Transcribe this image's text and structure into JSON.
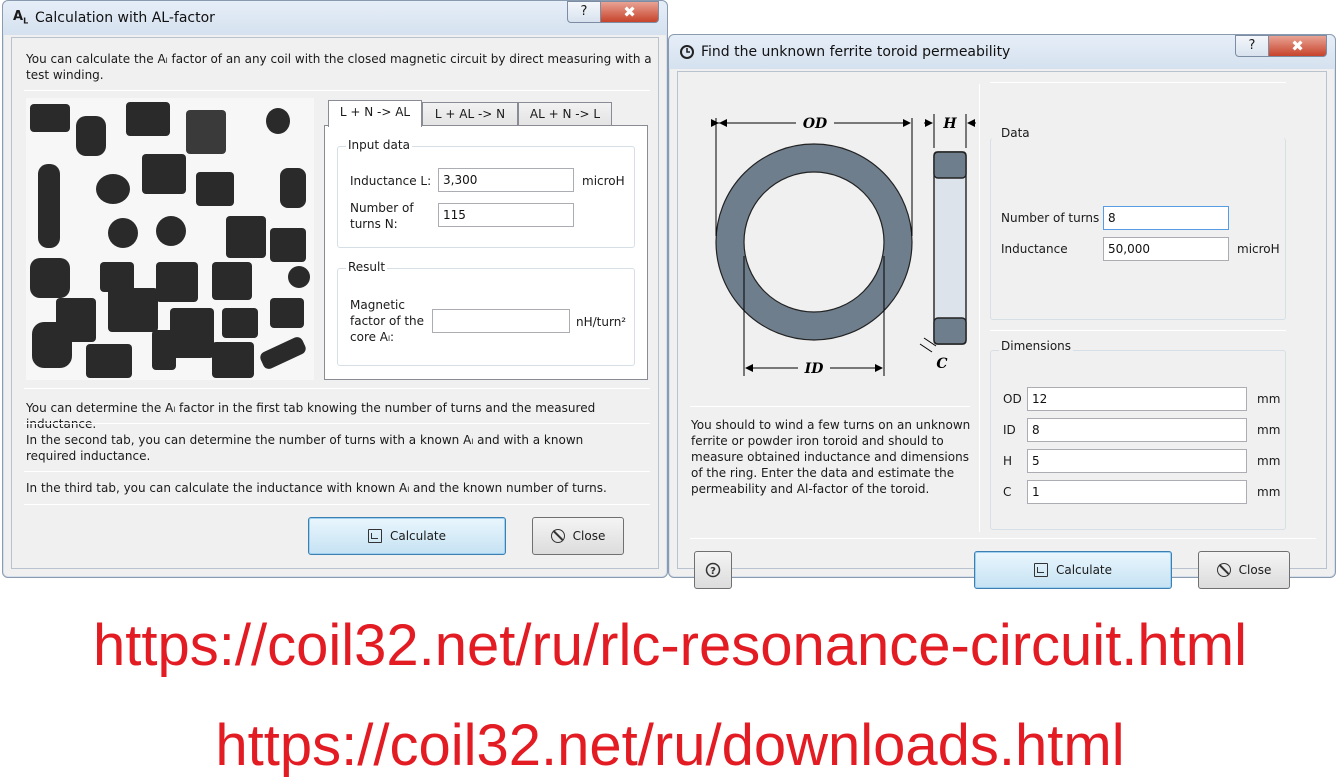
{
  "colors": {
    "url": "#e31b23",
    "accent": "#3c7fb1"
  },
  "left_window": {
    "icon": "A",
    "icon_sub": "L",
    "title": "Calculation with AL-factor",
    "intro": "You can calculate the Aₗ factor of an any coil with the closed magnetic circuit by direct measuring with a test winding.",
    "tabs": [
      "L + N -> AL",
      "L + AL -> N",
      "AL + N -> L"
    ],
    "input_group": "Input data",
    "inductance_label": "Inductance L:",
    "inductance_value": "3,300",
    "inductance_unit": "microH",
    "turns_label": "Number of turns N:",
    "turns_value": "115",
    "result_group": "Result",
    "factor_label": "Magnetic factor of the core Aₗ:",
    "factor_value": "",
    "factor_unit": "nH/turn²",
    "note1": "You can determine the Aₗ factor in the first tab knowing the number of turns and the measured inductance.",
    "note2": "In the second tab, you can determine the number of turns with a known Aₗ and with a known required inductance.",
    "note3": "In the third tab, you can calculate the inductance with known Aₗ and the known number of turns.",
    "calculate": "Calculate",
    "close": "Close",
    "help_glyph": "?",
    "close_glyph": "✖"
  },
  "right_window": {
    "title": "Find the unknown ferrite toroid permeability",
    "drawing": {
      "od": "OD",
      "id": "ID",
      "h": "H",
      "c": "C"
    },
    "data_group": "Data",
    "turns_label": "Number of turns",
    "turns_value": "8",
    "inductance_label": "Inductance",
    "inductance_value": "50,000",
    "inductance_unit": "microH",
    "dim_group": "Dimensions",
    "dims": [
      {
        "label": "OD",
        "value": "12",
        "unit": "mm"
      },
      {
        "label": "ID",
        "value": "8",
        "unit": "mm"
      },
      {
        "label": "H",
        "value": "5",
        "unit": "mm"
      },
      {
        "label": "C",
        "value": "1",
        "unit": "mm"
      }
    ],
    "description": "You should to wind a few turns on an unknown ferrite or powder iron toroid and should to measure obtained inductance and dimensions of the ring. Enter the data and estimate the permeability and Al-factor of the toroid.",
    "calculate": "Calculate",
    "close": "Close",
    "help_glyph": "?",
    "close_glyph": "✖"
  },
  "urls": [
    "https://coil32.net/ru/rlc-resonance-circuit.html",
    "https://coil32.net/ru/downloads.html"
  ]
}
